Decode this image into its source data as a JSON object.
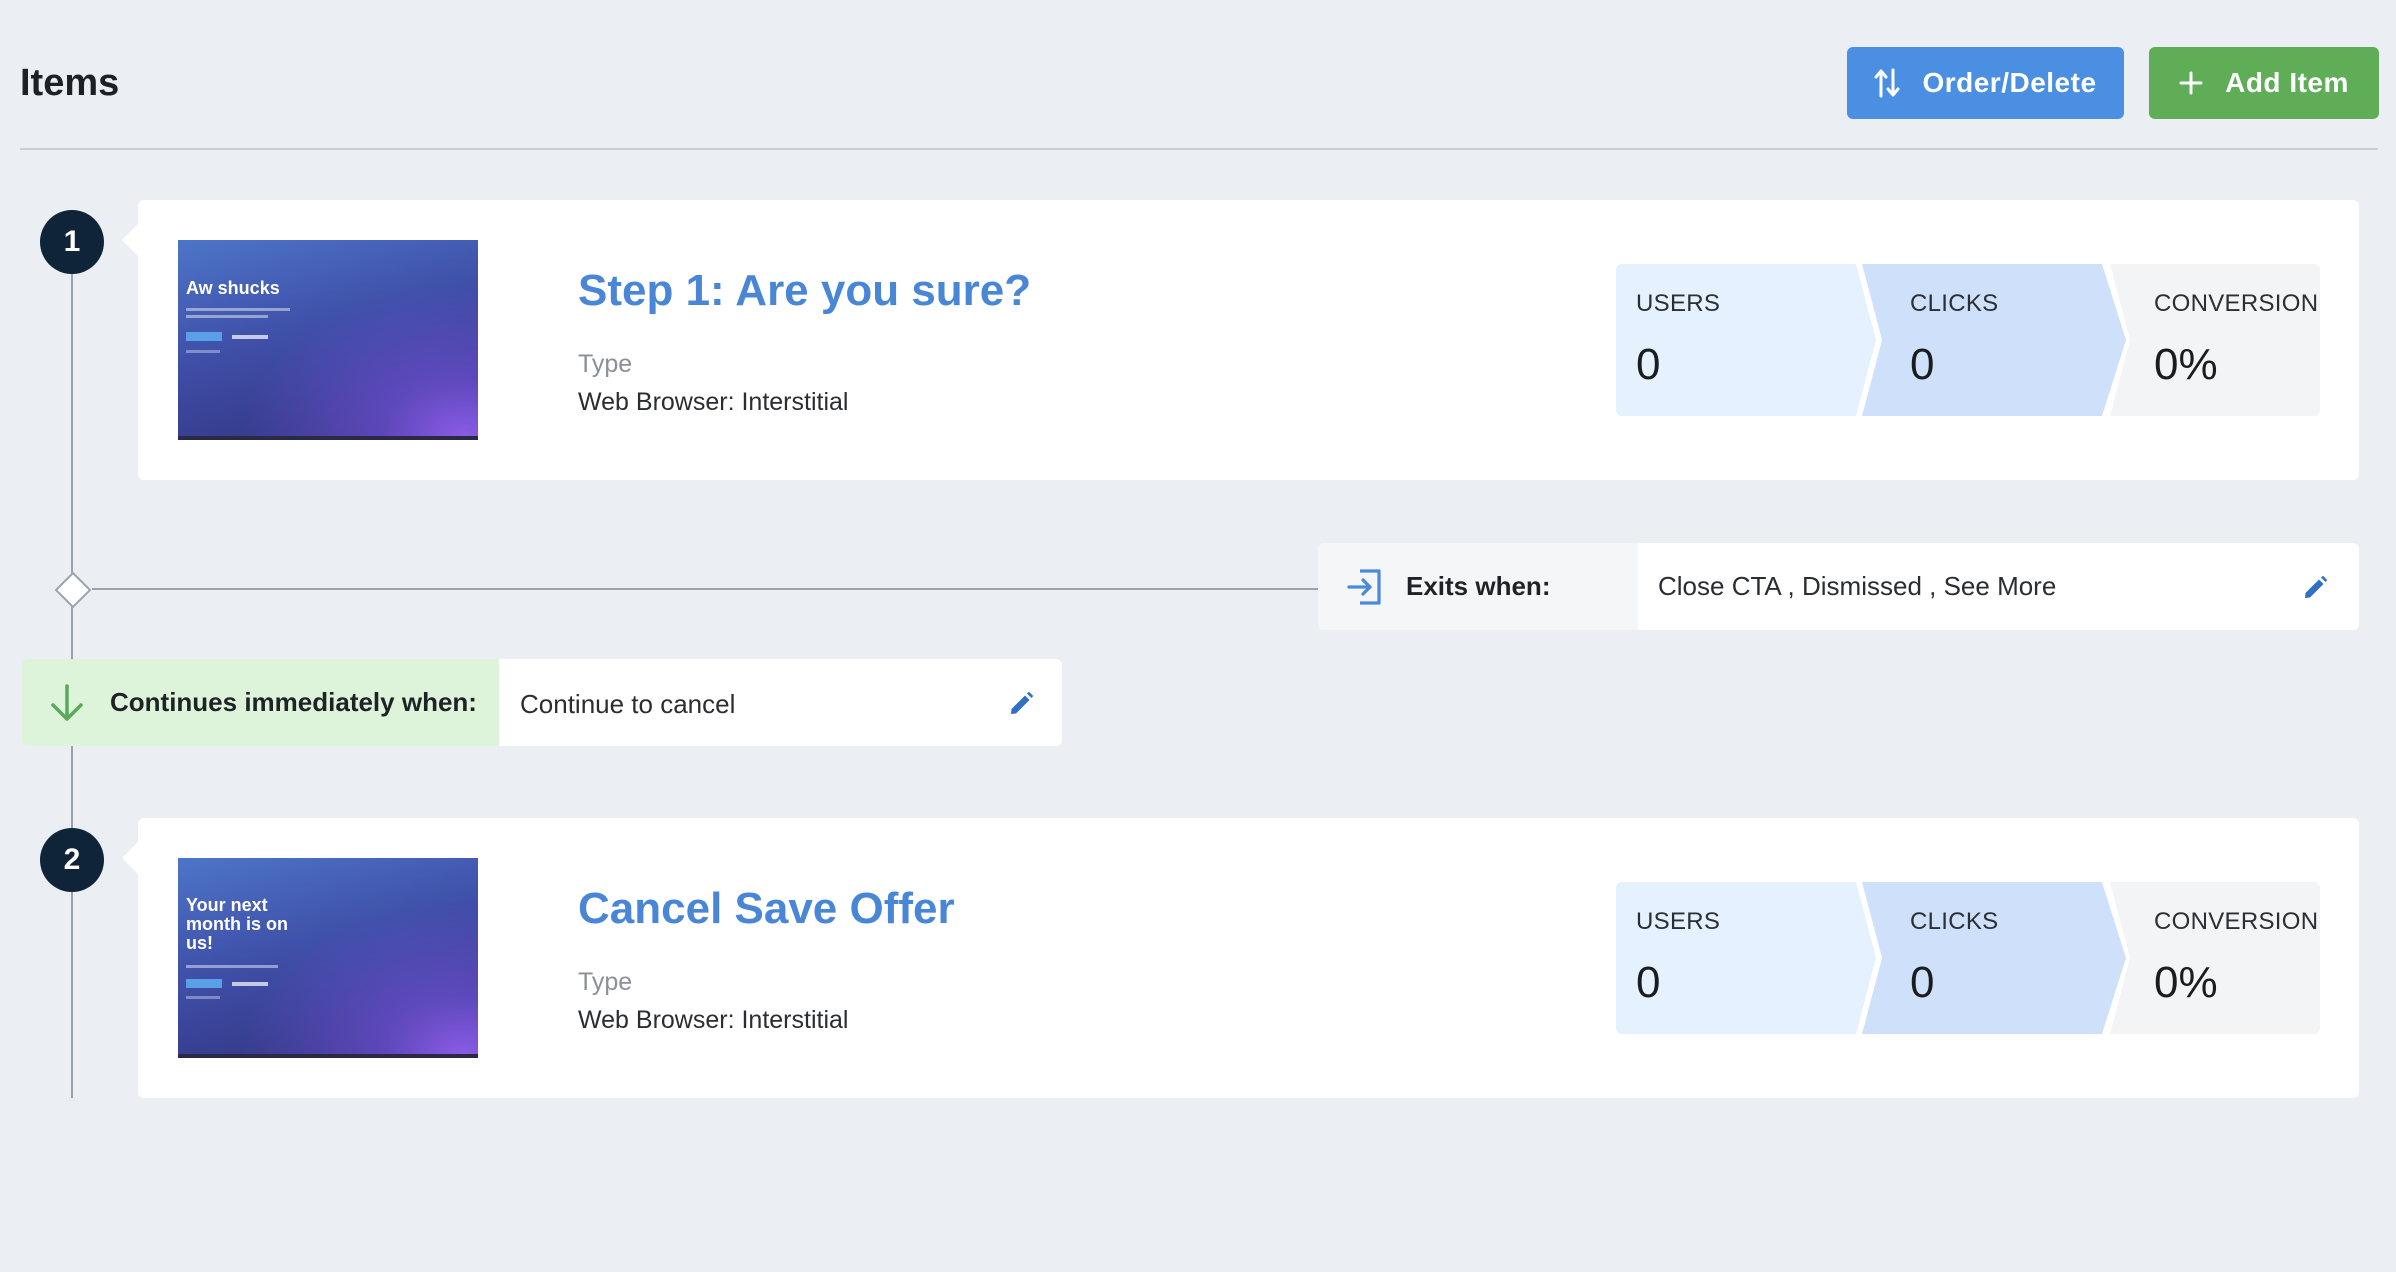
{
  "page": {
    "title": "Items"
  },
  "toolbar": {
    "order_delete_label": "Order/Delete",
    "add_item_label": "Add Item",
    "order_color": "#4b8fe2",
    "add_color": "#5fad56"
  },
  "steps": [
    {
      "number": "1",
      "title": "Step 1: Are you sure?",
      "type_label": "Type",
      "type_value": "Web Browser: Interstitial",
      "thumbnail": {
        "heading": "Aw shucks"
      },
      "stats": {
        "users_label": "USERS",
        "users_value": "0",
        "clicks_label": "CLICKS",
        "clicks_value": "0",
        "conversion_label": "CONVERSION",
        "conversion_value": "0%"
      }
    },
    {
      "number": "2",
      "title": "Cancel Save Offer",
      "type_label": "Type",
      "type_value": "Web Browser: Interstitial",
      "thumbnail": {
        "heading": "Your next month is on us!"
      },
      "stats": {
        "users_label": "USERS",
        "users_value": "0",
        "clicks_label": "CLICKS",
        "clicks_value": "0",
        "conversion_label": "CONVERSION",
        "conversion_value": "0%"
      }
    }
  ],
  "exits": {
    "label": "Exits when:",
    "value": "Close CTA , Dismissed , See More",
    "icon": "exit-icon"
  },
  "continues": {
    "label": "Continues immediately when:",
    "value": "Continue to cancel",
    "icon": "arrow-down-icon"
  },
  "colors": {
    "title_blue": "#4a86d6",
    "step_circle": "#0f2438",
    "continue_green": "#5aa85a"
  }
}
